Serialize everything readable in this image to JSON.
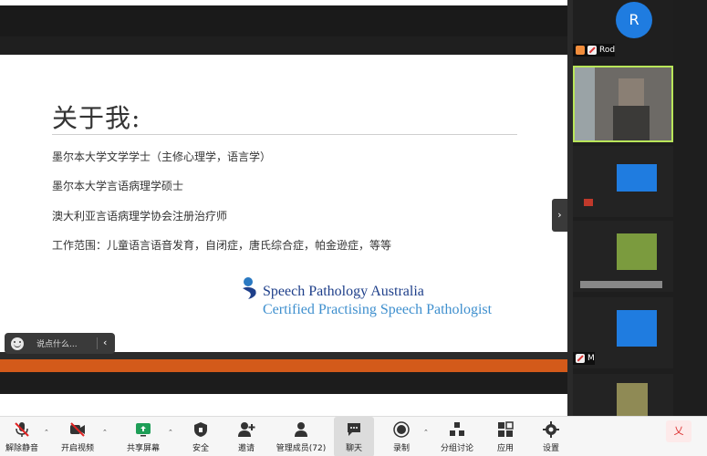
{
  "slide": {
    "title": "关于我:",
    "lines": [
      "墨尔本大学文学学士（主修心理学，语言学）",
      "墨尔本大学言语病理学硕士",
      "澳大利亚言语病理学协会注册治疗师",
      "工作范围：儿童语言语音发育，自闭症，唐氏综合症，帕金逊症，等等"
    ],
    "org_name": "Speech Pathology Australia",
    "org_cert": "Certified Practising Speech Pathologist"
  },
  "chat_bubble": {
    "placeholder": "说点什么..."
  },
  "participants": [
    {
      "initial": "R",
      "name": "Rod"
    },
    {
      "name": "M"
    }
  ],
  "toolbar": {
    "unmute": "解除静音",
    "video": "开启视频",
    "share": "共享屏幕",
    "security": "安全",
    "invite": "邀请",
    "participants": "管理成员(72)",
    "chat": "聊天",
    "record": "录制",
    "breakout": "分组讨论",
    "apps": "应用",
    "settings": "设置",
    "end": "乂"
  },
  "colors": {
    "accent_orange": "#d35a1a",
    "avatar_blue": "#1f7ce0",
    "active_speaker": "#b9e65a",
    "org_dark_blue": "#1e3f8a",
    "org_light_blue": "#3e8fce"
  },
  "icons": {
    "unmute": "mic-muted-icon",
    "video": "video-off-icon",
    "share": "share-screen-icon",
    "security": "shield-icon",
    "invite": "add-user-icon",
    "participants": "people-icon",
    "chat": "chat-icon",
    "record": "record-icon",
    "breakout": "breakout-rooms-icon",
    "apps": "apps-icon",
    "settings": "gear-icon"
  }
}
